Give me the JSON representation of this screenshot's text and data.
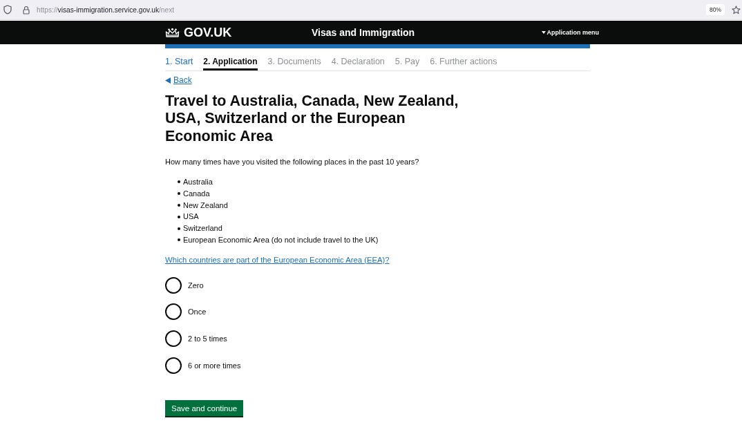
{
  "browser": {
    "url_scheme": "https://",
    "url_host": "visas-immigration.service.gov.uk",
    "url_path": "/next",
    "zoom": "80%"
  },
  "header": {
    "logo_text": "GOV.UK",
    "service_name": "Visas and Immigration",
    "menu_label": "Application menu"
  },
  "steps": [
    {
      "label": "1. Start",
      "selected": false,
      "completed": true
    },
    {
      "label": "2. Application",
      "selected": true,
      "completed": false
    },
    {
      "label": "3. Documents",
      "selected": false,
      "completed": false
    },
    {
      "label": "4. Declaration",
      "selected": false,
      "completed": false
    },
    {
      "label": "5. Pay",
      "selected": false,
      "completed": false
    },
    {
      "label": "6. Further actions",
      "selected": false,
      "completed": false
    }
  ],
  "back_link": "Back",
  "title": "Travel to Australia, Canada, New Zealand, USA, Switzerland or the European Economic Area",
  "question": "How many times have you visited the following places in the past 10 years?",
  "places": [
    "Australia",
    "Canada",
    "New Zealand",
    "USA",
    "Switzerland",
    "European Economic Area (do not include travel to the UK)"
  ],
  "eea_link": "Which countries are part of the European Economic Area (EEA)?",
  "options": [
    {
      "label": "Zero",
      "selected": false
    },
    {
      "label": "Once",
      "selected": false
    },
    {
      "label": "2 to 5 times",
      "selected": false
    },
    {
      "label": "6 or more times",
      "selected": false
    }
  ],
  "submit_button": "Save and continue"
}
